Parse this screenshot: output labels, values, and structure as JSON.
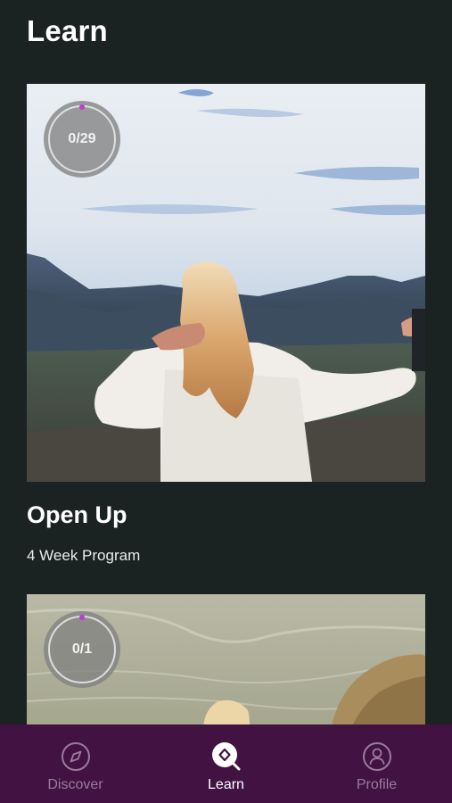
{
  "header": {
    "title": "Learn"
  },
  "programs": [
    {
      "progress": "0/29",
      "title": "Open Up",
      "subtitle": "4 Week Program"
    },
    {
      "progress": "0/1"
    }
  ],
  "nav": [
    {
      "label": "Discover",
      "icon": "compass-icon",
      "active": false
    },
    {
      "label": "Learn",
      "icon": "learn-search-icon",
      "active": true
    },
    {
      "label": "Profile",
      "icon": "profile-icon",
      "active": false
    }
  ],
  "colors": {
    "background": "#1a2222",
    "nav_background": "#411242",
    "progress_accent": "#c23ad0",
    "nav_inactive": "#9b7b9c"
  }
}
